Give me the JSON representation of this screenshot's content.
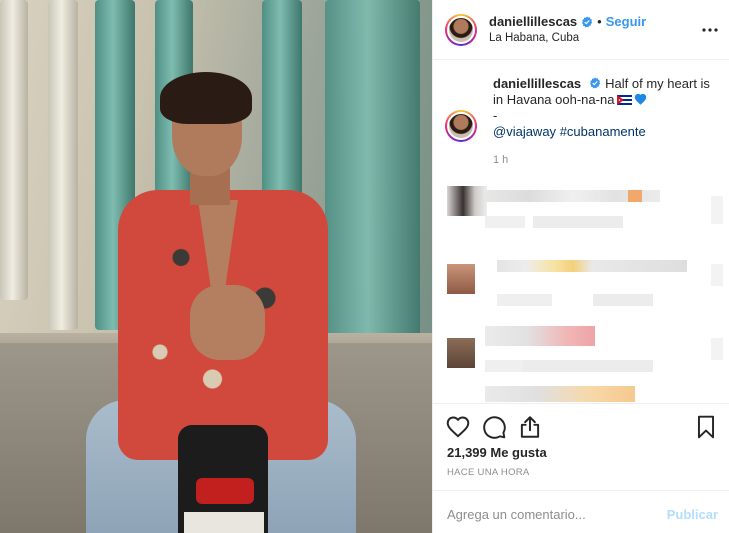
{
  "post": {
    "photo_description_icon": "photo",
    "header": {
      "username": "daniellillescas",
      "verified_icon": "verified-badge-icon",
      "separator": "•",
      "follow_label": "Seguir",
      "location": "La Habana, Cuba",
      "more_icon": "more-options-icon"
    },
    "caption": {
      "username": "daniellillescas",
      "text": "Half of my heart is in Havana ooh-na-na",
      "flag_icon": "cuba-flag-emoji",
      "heart_icon": "blue-heart-emoji",
      "line2": "-",
      "mention": "@viajaway",
      "hashtag": "#cubanamente",
      "time": "1 h"
    },
    "actions": {
      "like_icon": "heart-outline-icon",
      "comment_icon": "comment-icon",
      "share_icon": "share-icon",
      "save_icon": "bookmark-icon",
      "likes": "21,399 Me gusta",
      "timestamp": "HACE UNA HORA"
    },
    "comment_box": {
      "placeholder": "Agrega un comentario...",
      "publish_label": "Publicar"
    },
    "colors": {
      "accent": "#3897f0",
      "publish_disabled": "#b2dffc",
      "hashtag": "#003569",
      "muted": "#8e8e8e"
    }
  }
}
